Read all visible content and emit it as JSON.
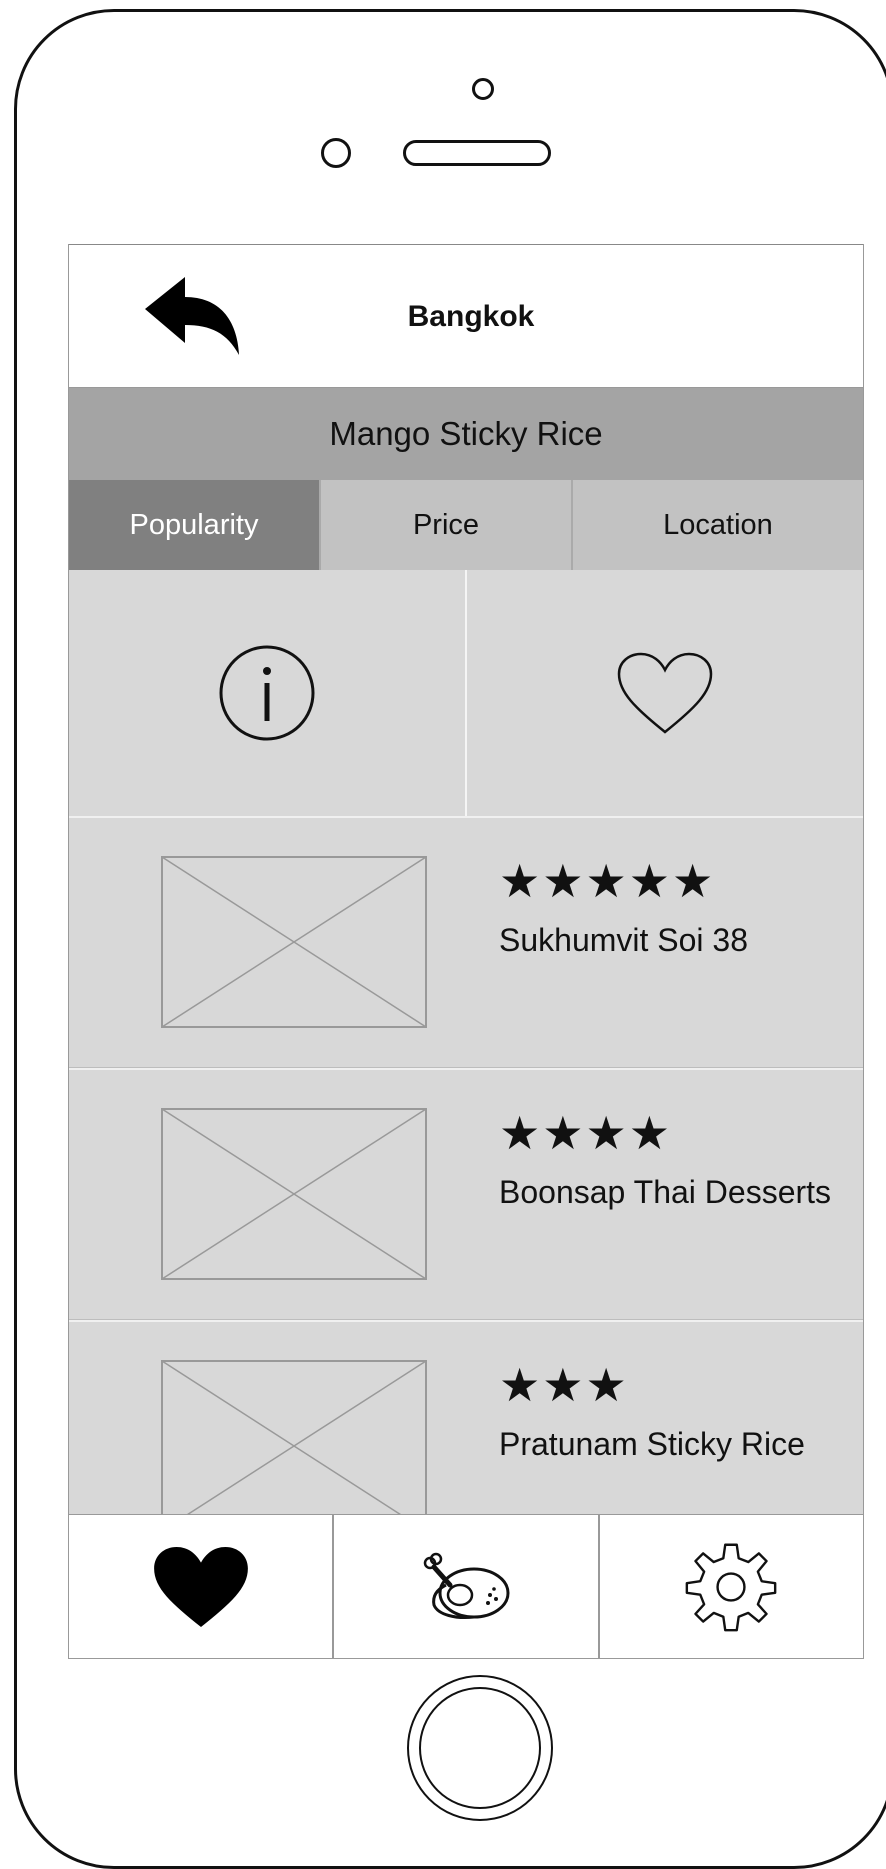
{
  "header": {
    "title": "Bangkok",
    "back_icon": "back-arrow-icon"
  },
  "dish": {
    "name": "Mango Sticky Rice"
  },
  "sort_tabs": [
    {
      "label": "Popularity",
      "active": true
    },
    {
      "label": "Price",
      "active": false
    },
    {
      "label": "Location",
      "active": false
    }
  ],
  "actions": [
    {
      "icon": "info-icon"
    },
    {
      "icon": "heart-outline-icon"
    }
  ],
  "restaurants": [
    {
      "stars": "★★★★★",
      "rating": 5,
      "name": "Sukhumvit Soi 38"
    },
    {
      "stars": "★★★★",
      "rating": 4,
      "name": "Boonsap Thai Desserts"
    },
    {
      "stars": "★★★",
      "rating": 3,
      "name": "Pratunam Sticky Rice"
    }
  ],
  "tabbar": [
    {
      "icon": "heart-filled-icon"
    },
    {
      "icon": "roast-chicken-icon"
    },
    {
      "icon": "gear-icon"
    }
  ]
}
